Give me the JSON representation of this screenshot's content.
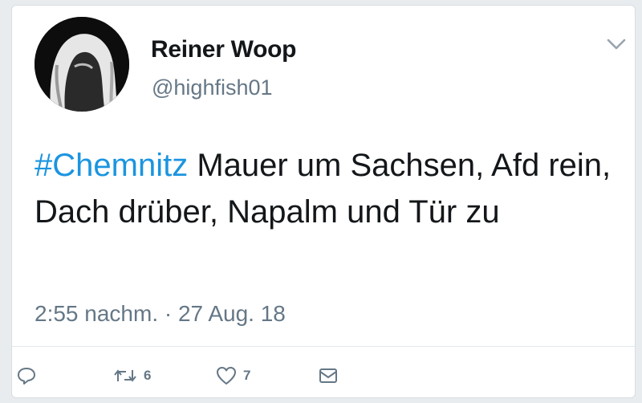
{
  "tweet": {
    "author_name": "Reiner Woop",
    "author_handle": "@highfish01",
    "hashtag": "#Chemnitz",
    "text": " Mauer um Sachsen, Afd rein, Dach drüber, Napalm und Tür zu",
    "timestamp": "2:55 nachm. · 27 Aug. 18"
  },
  "actions": {
    "retweet_count": "6",
    "like_count": "7"
  },
  "icons": {
    "avatar": "profile-photo",
    "menu": "chevron-down-icon",
    "reply": "reply-icon",
    "retweet": "retweet-icon",
    "like": "heart-icon",
    "message": "envelope-icon"
  },
  "colors": {
    "hashtag": "#1b95e0",
    "secondary_text": "#657786",
    "primary_text": "#14171a"
  }
}
